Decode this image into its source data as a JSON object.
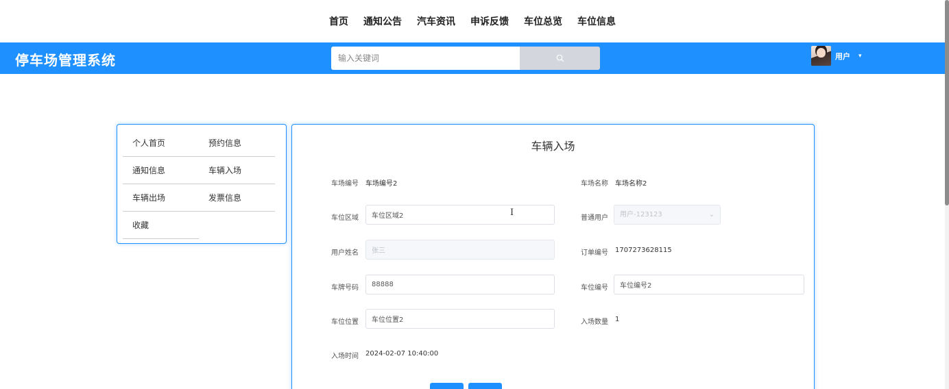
{
  "top_nav": [
    "首页",
    "通知公告",
    "汽车资讯",
    "申诉反馈",
    "车位总览",
    "车位信息"
  ],
  "header": {
    "brand": "停车场管理系统",
    "search_placeholder": "输入关键词",
    "user_name": "用户"
  },
  "side_menu": [
    "个人首页",
    "预约信息",
    "通知信息",
    "车辆入场",
    "车辆出场",
    "发票信息",
    "收藏"
  ],
  "form": {
    "title": "车辆入场",
    "lot_no_label": "车场编号",
    "lot_no_value": "车场编号2",
    "lot_name_label": "车场名称",
    "lot_name_value": "车场名称2",
    "area_label": "车位区域",
    "area_value": "车位区域2",
    "user_label": "普通用户",
    "user_value": "用户-123123",
    "username_label": "用户姓名",
    "username_value": "张三",
    "order_label": "订单编号",
    "order_value": "1707273628115",
    "plate_label": "车牌号码",
    "plate_value": "88888",
    "space_no_label": "车位编号",
    "space_no_value": "车位编号2",
    "position_label": "车位位置",
    "position_value": "车位位置2",
    "count_label": "入场数量",
    "count_value": "1",
    "time_label": "入场时间",
    "time_value": "2024-02-07 10:40:00"
  },
  "colors": {
    "accent": "#1e90ff",
    "search_button": "#d3d6dc"
  },
  "icons": {
    "search": "search-icon",
    "caret": "caret-down-icon",
    "select_arrow": "chevron-down-icon"
  }
}
